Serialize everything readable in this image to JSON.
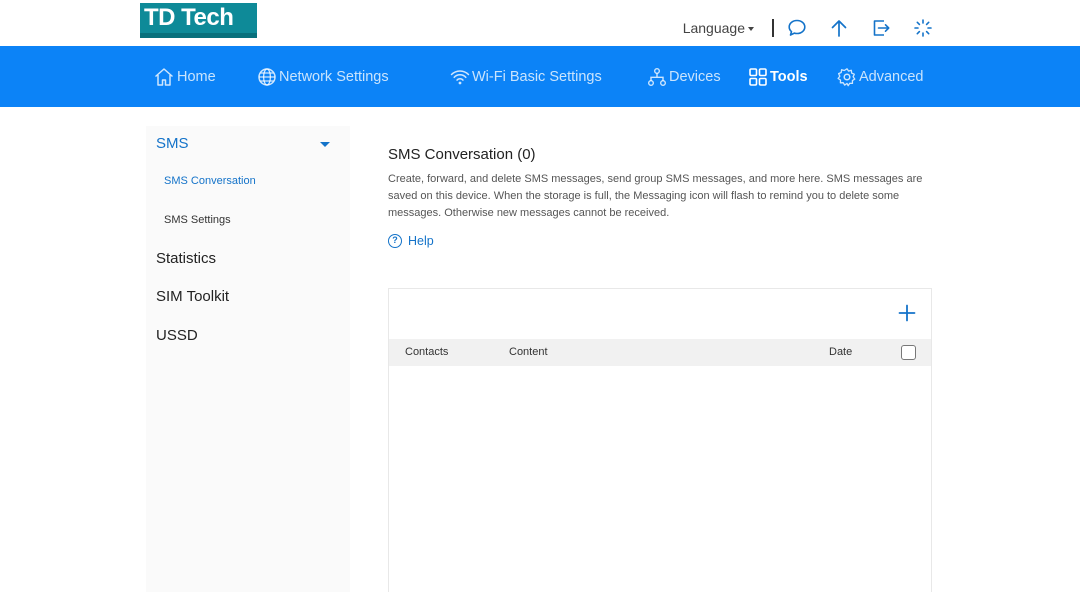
{
  "header": {
    "logo": "TD Tech",
    "language_label": "Language",
    "icons": [
      "message-icon",
      "upload-icon",
      "logout-icon",
      "loading-icon"
    ]
  },
  "nav": {
    "items": [
      {
        "label": "Home",
        "icon": "home-icon",
        "active": false
      },
      {
        "label": "Network Settings",
        "icon": "globe-icon",
        "active": false
      },
      {
        "label": "Wi-Fi Basic Settings",
        "icon": "wifi-icon",
        "active": false
      },
      {
        "label": "Devices",
        "icon": "devices-icon",
        "active": false
      },
      {
        "label": "Tools",
        "icon": "tools-icon",
        "active": true
      },
      {
        "label": "Advanced",
        "icon": "gear-icon",
        "active": false
      }
    ]
  },
  "sidebar": {
    "group": "SMS",
    "sub_items": [
      {
        "label": "SMS Conversation",
        "active": true
      },
      {
        "label": "SMS Settings",
        "active": false
      }
    ],
    "items": [
      "Statistics",
      "SIM Toolkit",
      "USSD"
    ]
  },
  "main": {
    "title": "SMS Conversation (0)",
    "description": "Create, forward, and delete SMS messages, send group SMS messages, and more here. SMS messages are saved on this device. When the storage is full, the Messaging icon will flash to remind you to delete some messages. Otherwise new messages cannot be received.",
    "help_label": "Help",
    "table": {
      "columns": [
        "Contacts",
        "Content",
        "Date"
      ],
      "rows": []
    }
  },
  "colors": {
    "nav_bg": "#0c83f7",
    "accent": "#1473c9",
    "logo_bg": "#0e8a98"
  }
}
